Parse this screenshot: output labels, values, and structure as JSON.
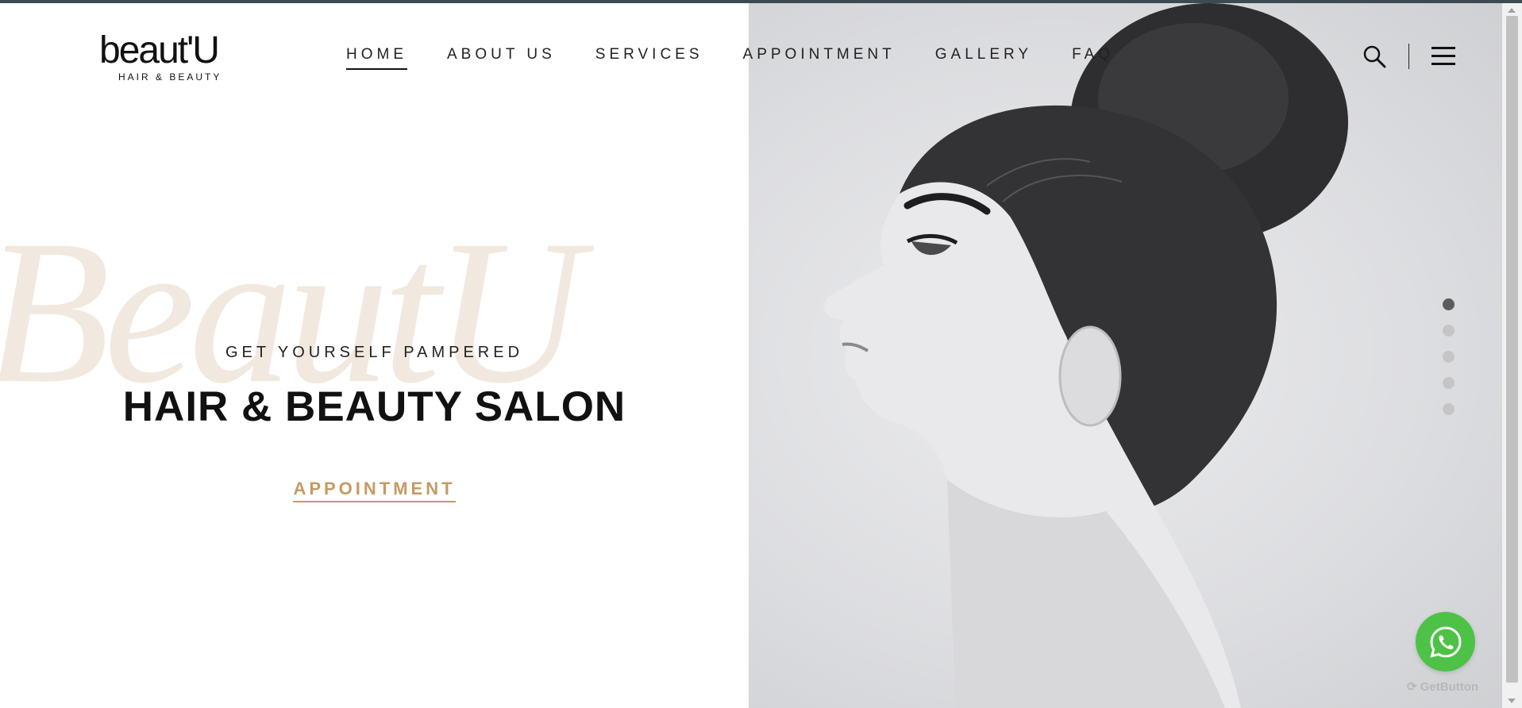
{
  "brand": {
    "name": "beaut'U",
    "subtitle": "HAIR & BEAUTY",
    "watermark": "BeautU"
  },
  "nav": {
    "items": [
      {
        "label": "HOME",
        "active": true
      },
      {
        "label": "ABOUT US",
        "active": false
      },
      {
        "label": "SERVICES",
        "active": false
      },
      {
        "label": "APPOINTMENT",
        "active": false
      },
      {
        "label": "GALLERY",
        "active": false
      },
      {
        "label": "FAQ",
        "active": false
      }
    ]
  },
  "header": {
    "search_icon": "search-icon",
    "menu_icon": "hamburger-menu-icon"
  },
  "hero": {
    "tagline": "GET YOURSELF PAMPERED",
    "headline": "HAIR & BEAUTY SALON",
    "cta_label": "APPOINTMENT",
    "image": "black-and-white profile portrait of a woman with a hair bun"
  },
  "slider": {
    "total_slides": 5,
    "active_index": 0
  },
  "widget": {
    "whatsapp_icon": "whatsapp-icon",
    "credit": "GetButton"
  },
  "colors": {
    "accent": "#c59a63",
    "text": "#111111",
    "watermark": "#f1e9df",
    "whatsapp": "#4dc247",
    "top_strip": "#3d4a52"
  }
}
